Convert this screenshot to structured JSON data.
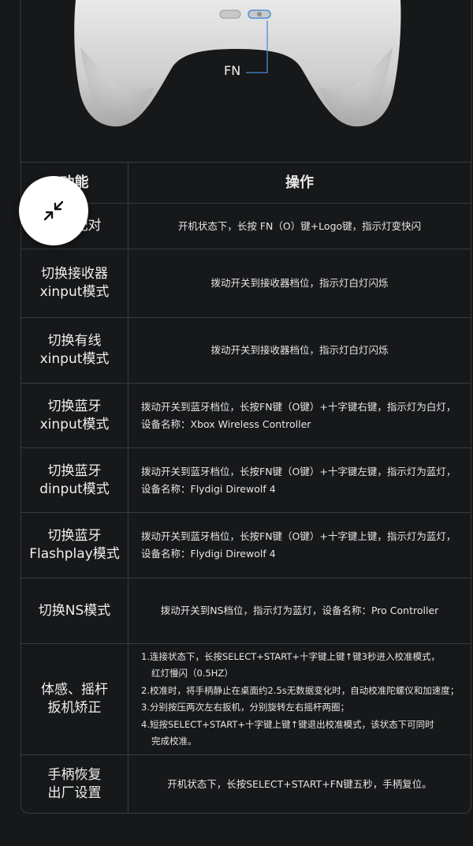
{
  "hero": {
    "fn_label": "FN"
  },
  "table": {
    "header": {
      "col1": "功能",
      "col2": "操作"
    },
    "rows": [
      {
        "func": [
          "进入配对"
        ],
        "op": [
          "开机状态下，长按 FN（O）键+Logo键，指示灯变快闪"
        ]
      },
      {
        "func": [
          "切换接收器",
          "xinput模式"
        ],
        "op": [
          "拨动开关到接收器档位，指示灯白灯闪烁"
        ]
      },
      {
        "func": [
          "切换有线",
          "xinput模式"
        ],
        "op": [
          "拨动开关到接收器档位，指示灯白灯闪烁"
        ]
      },
      {
        "func": [
          "切换蓝牙",
          "xinput模式"
        ],
        "op": [
          "拨动开关到蓝牙档位，长按FN键（O键）+十字键右键，指示灯为白灯，",
          "设备名称：Xbox Wireless Controller"
        ]
      },
      {
        "func": [
          "切换蓝牙",
          "dinput模式"
        ],
        "op": [
          "拨动开关到蓝牙档位，长按FN键（O键）+十字键左键，指示灯为蓝灯，",
          "设备名称：Flydigi Direwolf 4"
        ]
      },
      {
        "func": [
          "切换蓝牙",
          "Flashplay模式"
        ],
        "op": [
          "拨动开关到蓝牙档位，长按FN键（O键）+十字键上键，指示灯为蓝灯，",
          "设备名称：Flydigi Direwolf 4"
        ]
      },
      {
        "func": [
          "切换NS模式"
        ],
        "op": [
          "拨动开关到NS档位，指示灯为蓝灯，设备名称：Pro Controller"
        ]
      },
      {
        "func": [
          "体感、摇杆",
          "扳机矫正"
        ],
        "op": [
          "1.连接状态下，长按SELECT+START+十字键上键↑键3秒进入校准模式，",
          "红灯慢闪（0.5HZ）",
          "2.校准时，将手柄静止在桌面约2.5s无数据变化时，自动校准陀螺仪和加速度；",
          "3.分别按压两次左右扳机，分别旋转左右摇杆两圈；",
          "4.短按SELECT+START+十字键上键↑键退出校准模式，该状态下可同时",
          "完成校准。"
        ]
      },
      {
        "func": [
          "手柄恢复",
          "出厂设置"
        ],
        "op": [
          "开机状态下，长按SELECT+START+FN键五秒，手柄复位。"
        ]
      }
    ]
  },
  "fab": {
    "icon": "collapse-arrows-icon"
  }
}
